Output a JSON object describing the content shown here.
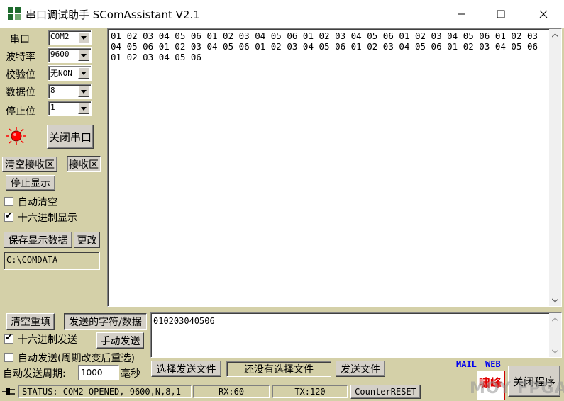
{
  "window": {
    "title": "串口调试助手 SComAssistant V2.1",
    "minimize_glyph": "—",
    "maximize_glyph": "☐",
    "close_glyph": "✕"
  },
  "settings": {
    "port_label": "串口",
    "port_value": "COM2",
    "baud_label": "波特率",
    "baud_value": "9600",
    "parity_label": "校验位",
    "parity_value": "无NON",
    "databits_label": "数据位",
    "databits_value": "8",
    "stopbits_label": "停止位",
    "stopbits_value": "1"
  },
  "port_status_icon": "red-led-icon",
  "close_port_label": "关闭串口",
  "receive": {
    "clear_label": "清空接收区",
    "area_label": "接收区",
    "stop_display_label": "停止显示",
    "auto_clear_label": "自动清空",
    "auto_clear_checked": false,
    "hex_display_label": "十六进制显示",
    "hex_display_checked": true,
    "save_label": "保存显示数据",
    "change_label": "更改",
    "path": "C:\\COMDATA",
    "text": "01 02 03 04 05 06 01 02 03 04 05 06 01 02 03 04 05 06 01 02 03 04 05 06 01 02 03 04 05 06 01 02 03 04 05 06 01 02 03 04 05 06 01 02 03 04 05 06 01 02 03 04 05 06 01 02 03 04 05 06"
  },
  "send": {
    "clear_label": "清空重填",
    "data_label": "发送的字符/数据",
    "hex_send_label": "十六进制发送",
    "hex_send_checked": true,
    "manual_send_label": "手动发送",
    "auto_send_label": "自动发送(周期改变后重选)",
    "auto_send_checked": false,
    "period_label": "自动发送周期:",
    "period_value": "1000",
    "period_unit": "毫秒",
    "text": "010203040506",
    "select_file_label": "选择发送文件",
    "file_status": "还没有选择文件",
    "send_file_label": "发送文件"
  },
  "links": {
    "mail": "MAIL",
    "web": "WEB"
  },
  "logo_text": "啸峰",
  "exit_label": "关闭程序",
  "status": {
    "text": "STATUS: COM2 OPENED, 9600,N,8,1",
    "rx": "RX:60",
    "tx": "TX:120",
    "counter_reset": "CounterRESET"
  },
  "watermark": "MOY FPGA",
  "colors": {
    "panel": "#d4d0a8",
    "led": "#ff0000",
    "link": "#0000ee"
  }
}
